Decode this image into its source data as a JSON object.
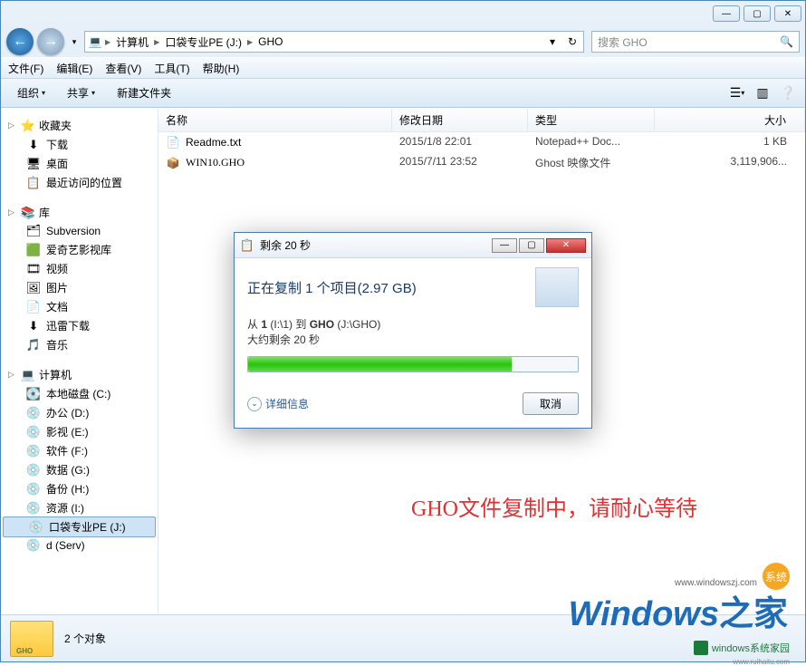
{
  "window": {
    "breadcrumbs": [
      "计算机",
      "口袋专业PE (J:)",
      "GHO"
    ],
    "search_placeholder": "搜索 GHO"
  },
  "menu": {
    "file": "文件(F)",
    "edit": "编辑(E)",
    "view": "查看(V)",
    "tools": "工具(T)",
    "help": "帮助(H)"
  },
  "toolbar": {
    "organize": "组织",
    "share": "共享",
    "new_folder": "新建文件夹"
  },
  "columns": {
    "name": "名称",
    "date": "修改日期",
    "type": "类型",
    "size": "大小"
  },
  "files": [
    {
      "name": "Readme.txt",
      "date": "2015/1/8 22:01",
      "type": "Notepad++ Doc...",
      "size": "1 KB"
    },
    {
      "name": "WIN10.GHO",
      "date": "2015/7/11 23:52",
      "type": "Ghost 映像文件",
      "size": "3,119,906..."
    }
  ],
  "sidebar": {
    "favorites": {
      "label": "收藏夹",
      "items": [
        {
          "label": "下载",
          "icon": "⬇"
        },
        {
          "label": "桌面",
          "icon": "🖥"
        },
        {
          "label": "最近访问的位置",
          "icon": "📋"
        }
      ]
    },
    "libraries": {
      "label": "库",
      "items": [
        {
          "label": "Subversion",
          "icon": "🗂"
        },
        {
          "label": "爱奇艺影视库",
          "icon": "🟩"
        },
        {
          "label": "视频",
          "icon": "🎞"
        },
        {
          "label": "图片",
          "icon": "🖼"
        },
        {
          "label": "文档",
          "icon": "📄"
        },
        {
          "label": "迅雷下载",
          "icon": "⬇"
        },
        {
          "label": "音乐",
          "icon": "🎵"
        }
      ]
    },
    "computer": {
      "label": "计算机",
      "items": [
        {
          "label": "本地磁盘 (C:)",
          "icon": "💽"
        },
        {
          "label": "办公 (D:)",
          "icon": "💿"
        },
        {
          "label": "影视 (E:)",
          "icon": "💿"
        },
        {
          "label": "软件 (F:)",
          "icon": "💿"
        },
        {
          "label": "数据 (G:)",
          "icon": "💿"
        },
        {
          "label": "备份 (H:)",
          "icon": "💿"
        },
        {
          "label": "资源 (I:)",
          "icon": "💿"
        },
        {
          "label": "口袋专业PE (J:)",
          "icon": "💿",
          "selected": true
        },
        {
          "label": "d (Serv)",
          "icon": "💿"
        }
      ]
    }
  },
  "status": {
    "count": "2 个对象"
  },
  "dialog": {
    "title": "剩余 20 秒",
    "headline": "正在复制 1 个项目(2.97 GB)",
    "line1_prefix": "从 ",
    "line1_src": "1",
    "line1_srcpath": " (I:\\1) 到 ",
    "line1_tgt": "GHO",
    "line1_tgtpath": " (J:\\GHO)",
    "line2": "大约剩余 20 秒",
    "details": "详细信息",
    "cancel": "取消",
    "progress_pct": 80
  },
  "annotation": "GHO文件复制中，请耐心等待",
  "logos": {
    "url1": "www.windowszj.com",
    "badge": "系统",
    "main": "Windows",
    "suffix": "之家",
    "small": "windows系统家园",
    "url2": "www.ruihaitu.com"
  }
}
